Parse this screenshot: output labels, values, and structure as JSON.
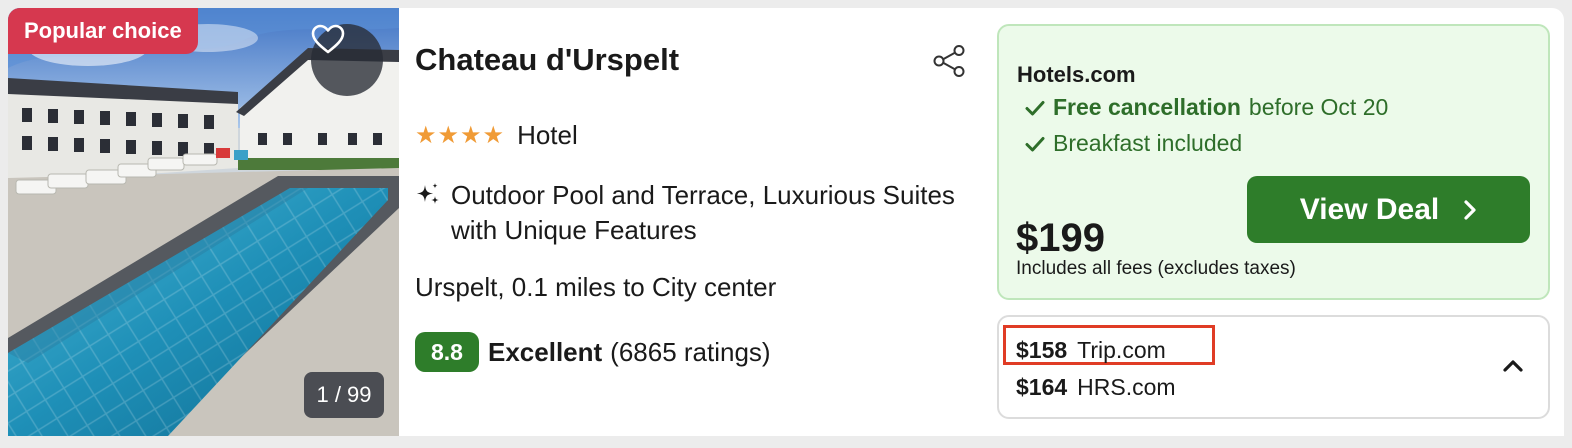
{
  "listing": {
    "badge": "Popular choice",
    "photo_counter": "1 / 99",
    "name": "Chateau d'Urspelt",
    "star_count": 4,
    "type": "Hotel",
    "highlights": "Outdoor Pool and Terrace, Luxurious Suites with Unique Features",
    "location": "Urspelt, 0.1 miles to City center",
    "rating": {
      "score": "8.8",
      "label": "Excellent",
      "count": "(6865 ratings)"
    },
    "icons": {
      "favorite": "heart-icon",
      "share": "share-icon",
      "highlight": "sparkle-icon"
    }
  },
  "deal": {
    "provider": "Hotels.com",
    "perk_1_bold": "Free cancellation",
    "perk_1_rest": "before Oct 20",
    "perk_2": "Breakfast included",
    "price": "$199",
    "button_label": "View Deal",
    "fees_note": "Includes all fees (excludes taxes)"
  },
  "other_offers": [
    {
      "price": "$158",
      "provider": "Trip.com"
    },
    {
      "price": "$164",
      "provider": "HRS.com"
    }
  ],
  "colors": {
    "badge": "#d6384f",
    "primary_green": "#2e7d2a",
    "deal_bg": "#ecfaea",
    "star": "#f09b36",
    "highlight_outline": "#e03c25"
  }
}
